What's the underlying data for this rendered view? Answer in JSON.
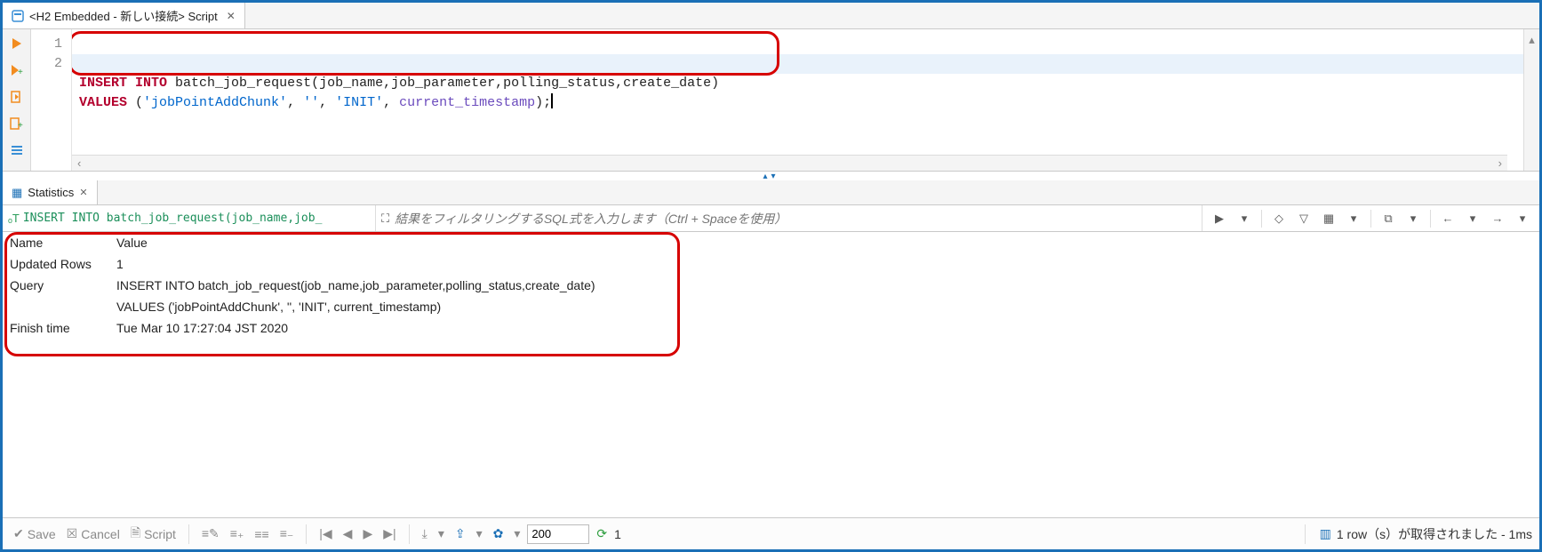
{
  "editor": {
    "tab_title": "<H2 Embedded - 新しい接続> Script",
    "line_numbers": [
      "1",
      "2"
    ],
    "line1": {
      "kw1": "INSERT",
      "kw2": "INTO",
      "rest": " batch_job_request(job_name,job_parameter,polling_status,create_date)"
    },
    "line2": {
      "kw": "VALUES",
      "open": " (",
      "s1": "'jobPointAddChunk'",
      "c1": ", ",
      "s2": "''",
      "c2": ", ",
      "s3": "'INIT'",
      "c3": ", ",
      "fn": "current_timestamp",
      "close": ");"
    }
  },
  "stats": {
    "tab_title": "Statistics",
    "filter_prefix": "INSERT INTO batch_job_request(job_name,job_",
    "filter_placeholder": "結果をフィルタリングするSQL式を入力します（Ctrl + Spaceを使用）",
    "columns": {
      "name": "Name",
      "value": "Value"
    },
    "rows": [
      {
        "name": "Updated Rows",
        "value": "1"
      },
      {
        "name": "Query",
        "value": "INSERT INTO batch_job_request(job_name,job_parameter,polling_status,create_date)"
      },
      {
        "name": "",
        "value": "VALUES ('jobPointAddChunk', '', 'INIT', current_timestamp)"
      },
      {
        "name": "Finish time",
        "value": "Tue Mar 10 17:27:04 JST 2020"
      }
    ]
  },
  "statusbar": {
    "save": "Save",
    "cancel": "Cancel",
    "script": "Script",
    "fetch_size": "200",
    "refresh_count": "1",
    "status": "1 row（s）が取得されました - 1ms"
  }
}
